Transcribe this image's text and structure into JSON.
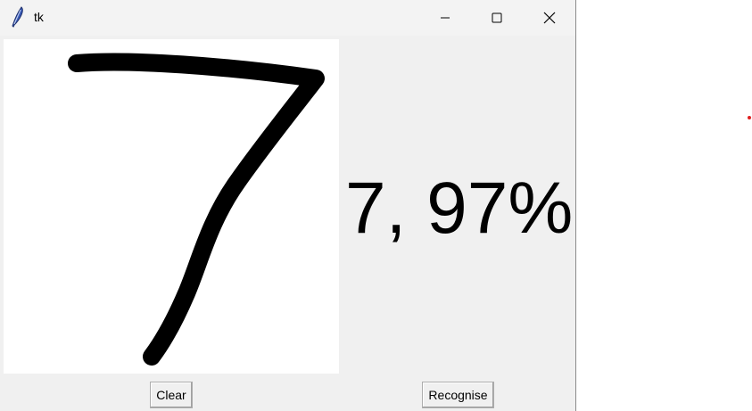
{
  "window": {
    "title": "tk"
  },
  "titlebar_icons": {
    "app": "feather-icon",
    "minimize": "minimize-icon",
    "maximize": "maximize-icon",
    "close": "close-icon"
  },
  "prediction": {
    "text": "7, 97%"
  },
  "buttons": {
    "clear_label": "Clear",
    "recognise_label": "Recognise"
  },
  "colors": {
    "window_bg": "#f0f0f0",
    "canvas_bg": "#ffffff",
    "stroke": "#000000",
    "indicator_dot": "#e02020"
  }
}
